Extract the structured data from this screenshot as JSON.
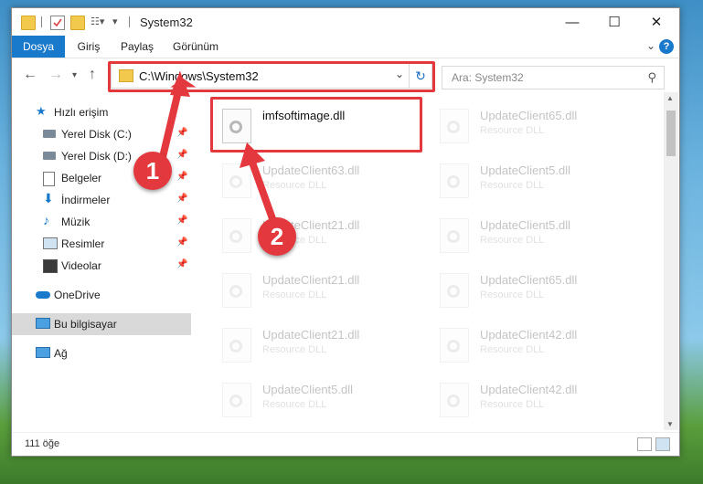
{
  "window": {
    "title": "System32"
  },
  "ribbon": {
    "tabs": [
      "Dosya",
      "Giriş",
      "Paylaş",
      "Görünüm"
    ],
    "help": "?"
  },
  "nav": {
    "address": "C:\\Windows\\System32",
    "search_placeholder": "Ara: System32"
  },
  "sidebar": {
    "items": [
      {
        "label": "Hızlı erişim",
        "icon": "star-icon"
      },
      {
        "label": "Yerel Disk (C:)",
        "icon": "drive-icon",
        "pinned": true
      },
      {
        "label": "Yerel Disk (D:)",
        "icon": "drive-icon",
        "pinned": true
      },
      {
        "label": "Belgeler",
        "icon": "document-icon",
        "pinned": true
      },
      {
        "label": "İndirmeler",
        "icon": "download-icon",
        "pinned": true
      },
      {
        "label": "Müzik",
        "icon": "music-icon",
        "pinned": true
      },
      {
        "label": "Resimler",
        "icon": "pictures-icon",
        "pinned": true
      },
      {
        "label": "Videolar",
        "icon": "video-icon",
        "pinned": true
      },
      {
        "label": "OneDrive",
        "icon": "cloud-icon"
      },
      {
        "label": "Bu bilgisayar",
        "icon": "computer-icon",
        "selected": true
      },
      {
        "label": "Ağ",
        "icon": "network-icon"
      }
    ]
  },
  "files": {
    "highlighted": {
      "name": "imfsoftimage.dll"
    },
    "items": [
      {
        "name": "UpdateClient65.dll",
        "type": "Resource DLL"
      },
      {
        "name": "UpdateClient63.dll",
        "type": "Resource DLL"
      },
      {
        "name": "UpdateClient5.dll",
        "type": "Resource DLL"
      },
      {
        "name": "UpdateClient21.dll",
        "type": "Resource DLL"
      },
      {
        "name": "UpdateClient5.dll",
        "type": "Resource DLL"
      },
      {
        "name": "UpdateClient21.dll",
        "type": "Resource DLL"
      },
      {
        "name": "UpdateClient65.dll",
        "type": "Resource DLL"
      },
      {
        "name": "UpdateClient21.dll",
        "type": "Resource DLL"
      },
      {
        "name": "UpdateClient42.dll",
        "type": "Resource DLL"
      },
      {
        "name": "UpdateClient5.dll",
        "type": "Resource DLL"
      },
      {
        "name": "UpdateClient42.dll",
        "type": "Resource DLL"
      }
    ]
  },
  "status": {
    "count": "111 öğe"
  },
  "callouts": [
    "1",
    "2"
  ],
  "colors": {
    "accent": "#1979ca",
    "highlight": "#e3383e"
  }
}
